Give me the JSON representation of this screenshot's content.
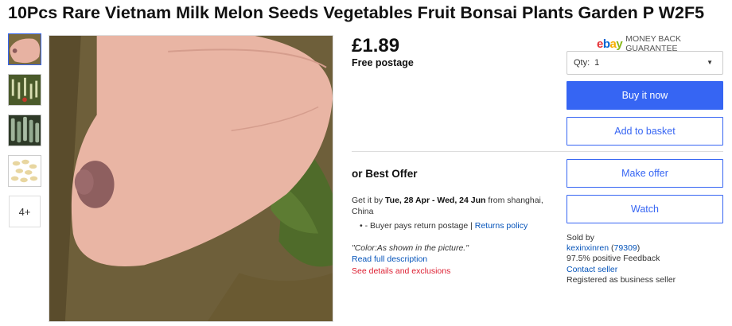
{
  "listing": {
    "title": "10Pcs Rare Vietnam Milk Melon Seeds Vegetables Fruit Bonsai Plants Garden P W2F5"
  },
  "gallery": {
    "more_label": "4+"
  },
  "pricing": {
    "price": "£1.89",
    "postage": "Free postage"
  },
  "guarantee": {
    "logo_e": "e",
    "logo_b": "b",
    "logo_a": "a",
    "logo_y": "y",
    "text": "MONEY BACK GUARANTEE"
  },
  "quantity": {
    "label": "Qty:",
    "value": "1"
  },
  "buttons": {
    "buy_now": "Buy it now",
    "add_basket": "Add to basket",
    "make_offer": "Make offer",
    "watch": "Watch"
  },
  "offer": {
    "label": "or Best Offer"
  },
  "delivery": {
    "prefix": "Get it by ",
    "dates": "Tue, 28 Apr - Wed, 24 Jun",
    "suffix": " from shanghai, China"
  },
  "returns": {
    "text": "• - Buyer pays return postage | ",
    "policy_link": "Returns policy"
  },
  "description": {
    "color_note": "\"Color:As shown in the picture.\"",
    "read_full": "Read full description",
    "see_details": "See details and exclusions"
  },
  "seller": {
    "sold_by": "Sold by",
    "name": "kexinxinren",
    "feedback_count": "79309",
    "positive": "97.5% positive Feedback",
    "contact": "Contact seller",
    "registered": "Registered as business seller"
  },
  "colors": {
    "accent": "#3665f3",
    "link": "#0654ba",
    "alert": "#dd1e31"
  },
  "icons": {
    "dropdown": "chevron-down-icon"
  }
}
